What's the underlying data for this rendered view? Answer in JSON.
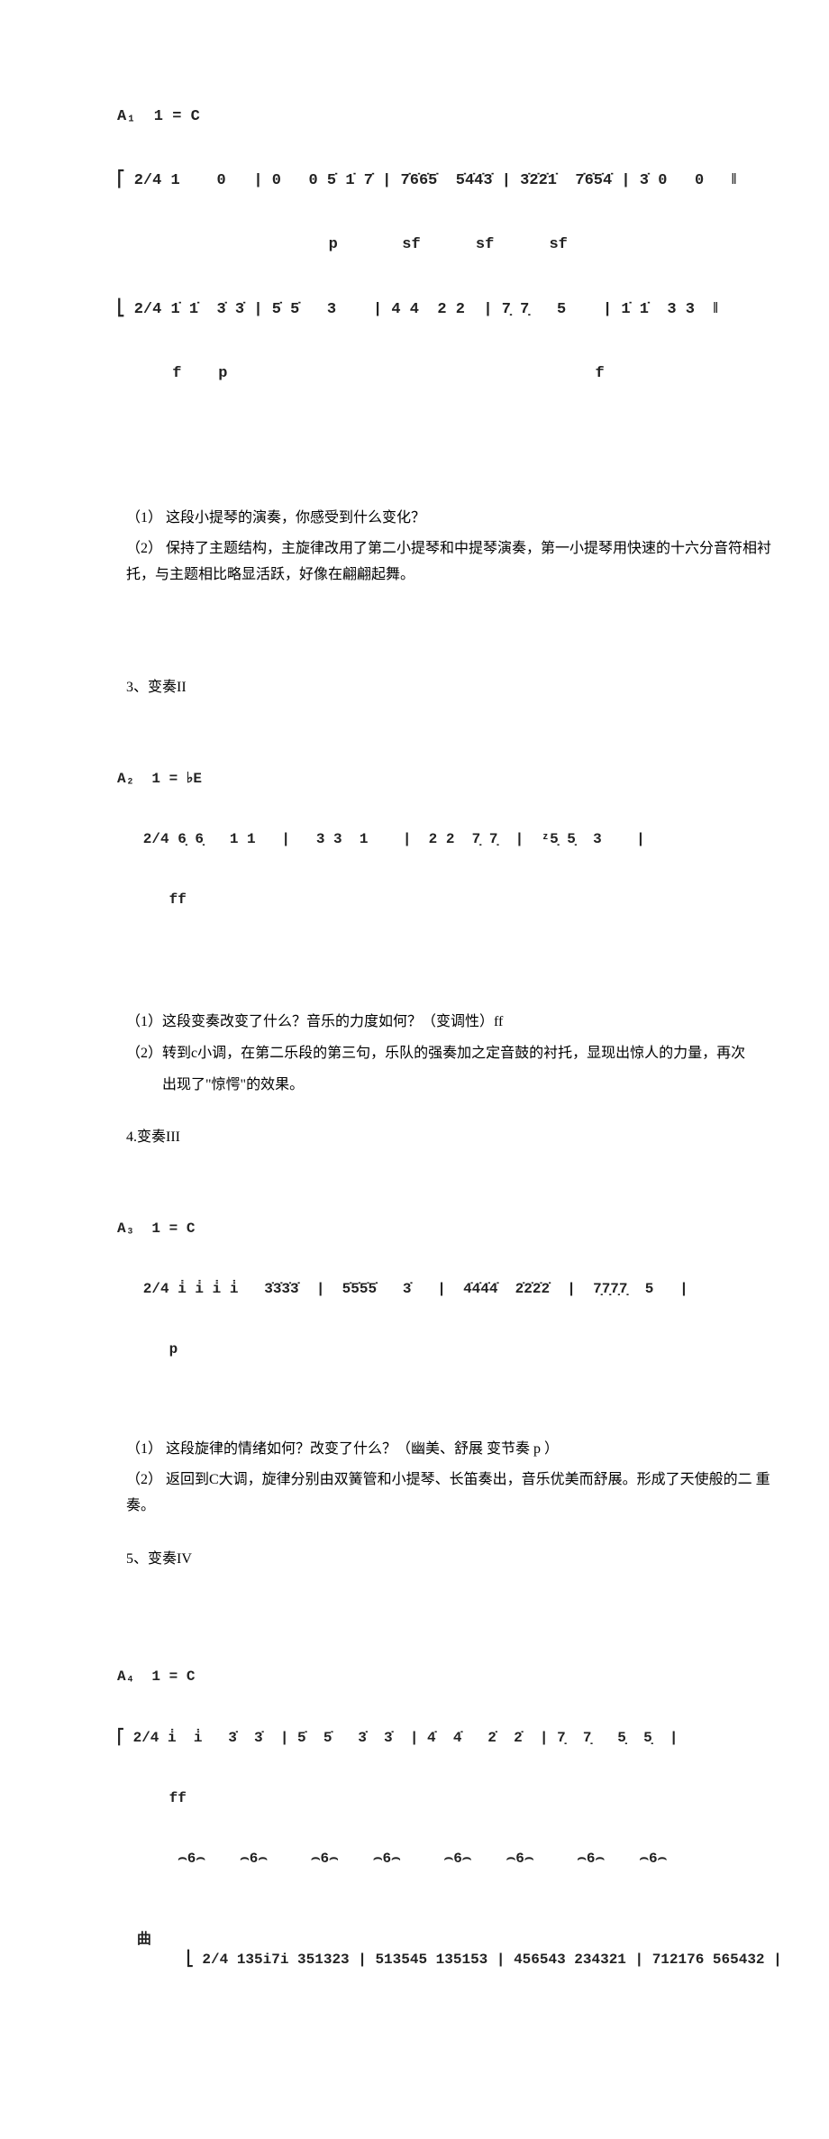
{
  "scoreA1": {
    "label": "A₁  1 = C",
    "line1": "⎡ 2/4 1    0   | 0   0 5̇ 1̇ 7̇ | 7̇6̇6̇5̇  5̇4̇4̇3̇ | 3̇2̇2̇1̇  7̇6̇5̇4̇ | 3̇ 0   0   ‖",
    "dyn1": "                       p       sf      sf      sf",
    "line2": "⎣ 2/4 1̇ 1̇  3̇ 3̇ | 5̇ 5̇   3    | 4 4  2 2  | 7̣ 7̣   5    | 1̇ 1̇  3 3  ‖",
    "dyn2": "      f    p                                        f"
  },
  "q1_1": "（1）  这段小提琴的演奏，你感受到什么变化？",
  "q1_2": "（2）  保持了主题结构，主旋律改用了第二小提琴和中提琴演奏，第一小提琴用快速的十六分音符相衬托，与主题相比略显活跃，好像在翩翩起舞。",
  "section3": "3、变奏II",
  "scoreA2": {
    "label": "A₂  1 = ♭E",
    "line1": "   2/4 6̣ 6̣   1 1   |   3 3  1    |  2 2  7̣ 7̣  |  ᶻ5̣ 5̣  3    |",
    "dyn1": "      ff"
  },
  "q2_1": "（1）这段变奏改变了什么？音乐的力度如何？（变调性）ff",
  "q2_2": "（2）转到c小调，在第二乐段的第三句，乐队的强奏加之定音鼓的衬托，显现出惊人的力量，再次",
  "q2_3": "出现了\"惊愕\"的效果。",
  "section4": "4.变奏III",
  "scoreA3": {
    "label": "A₃  1 = C",
    "line1": "   2/4 i̇ i̇ i̇ i̇   3̇3̇3̇3̇  |  5̇5̇5̇5̇   3̇   |  4̇4̇4̇4̇  2̇2̇2̇2̇  |  7̣7̣7̣7̣  5   |",
    "dyn1": "      p"
  },
  "q3_1": "（1）   这段旋律的情绪如何？改变了什么？（幽美、舒展      变节奏   p  ）",
  "q3_2": "（2）   返回到C大调，旋律分别由双簧管和小提琴、长笛奏出，音乐优美而舒展。形成了天使般的二 重奏。",
  "section5": "5、变奏IV",
  "leftChar": "曲",
  "scoreA4": {
    "label": "A₄  1 = C",
    "line1": "⎡ 2/4 i̇  i̇   3̇  3̇  | 5̇  5̇   3̇  3̇  | 4̇  4̇   2̇  2̇  | 7̣  7̣   5̣  5̣  |",
    "dyn1": "      ff",
    "line2": "⎣ 2/4 135i7i 351323 | 513545 135153 | 456543 234321 | 712176 565432 |",
    "triplet": "       ⌢6⌢    ⌢6⌢     ⌢6⌢    ⌢6⌢     ⌢6⌢    ⌢6⌢     ⌢6⌢    ⌢6⌢"
  }
}
